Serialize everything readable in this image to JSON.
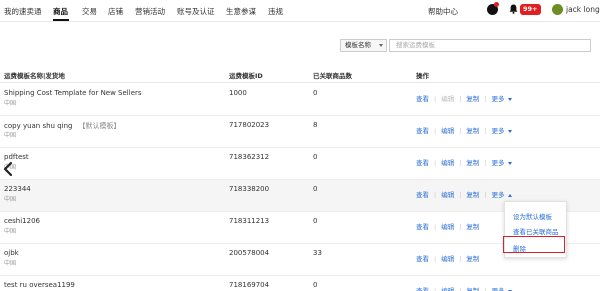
{
  "nav": {
    "items": [
      "我的速卖通",
      "商品",
      "交易",
      "店铺",
      "营销活动",
      "账号及认证",
      "生意参谋",
      "违规"
    ],
    "active_index": 1,
    "help": "帮助中心",
    "badge": "99+",
    "user": "jack long"
  },
  "search": {
    "filter_label": "模板名称",
    "placeholder": "搜索运费模板"
  },
  "table": {
    "headers": [
      "运费模板名称|发货地",
      "运费模板ID",
      "已关联商品数",
      "操作"
    ],
    "rows": [
      {
        "name": "Shipping Cost Template for New Sellers",
        "tag": "",
        "sub": "中国",
        "id": "1000",
        "count": "0",
        "edit_disabled": true
      },
      {
        "name": "copy yuan shu qing",
        "tag": "【默认模板】",
        "sub": "中国",
        "id": "717802023",
        "count": "8",
        "edit_disabled": false
      },
      {
        "name": "pdftest",
        "tag": "",
        "sub": "中国",
        "id": "718362312",
        "count": "0",
        "edit_disabled": false
      },
      {
        "name": "223344",
        "tag": "",
        "sub": "中国",
        "id": "718338200",
        "count": "0",
        "edit_disabled": false
      },
      {
        "name": "ceshi1206",
        "tag": "",
        "sub": "中国",
        "id": "718311213",
        "count": "0",
        "edit_disabled": false
      },
      {
        "name": "ojbk",
        "tag": "",
        "sub": "中国",
        "id": "200578004",
        "count": "33",
        "edit_disabled": false
      },
      {
        "name": "test ru oversea1199",
        "tag": "",
        "sub": "",
        "id": "718169704",
        "count": "0",
        "edit_disabled": false
      }
    ],
    "actions": {
      "view": "查看",
      "edit": "编辑",
      "copy": "复制",
      "more": "更多"
    }
  },
  "dropdown": {
    "items": [
      "设为默认模板",
      "查看已关联商品",
      "删除"
    ]
  },
  "colors": {
    "link": "#2a6fd6",
    "badge": "#e02020",
    "highlight": "#d9202c"
  }
}
